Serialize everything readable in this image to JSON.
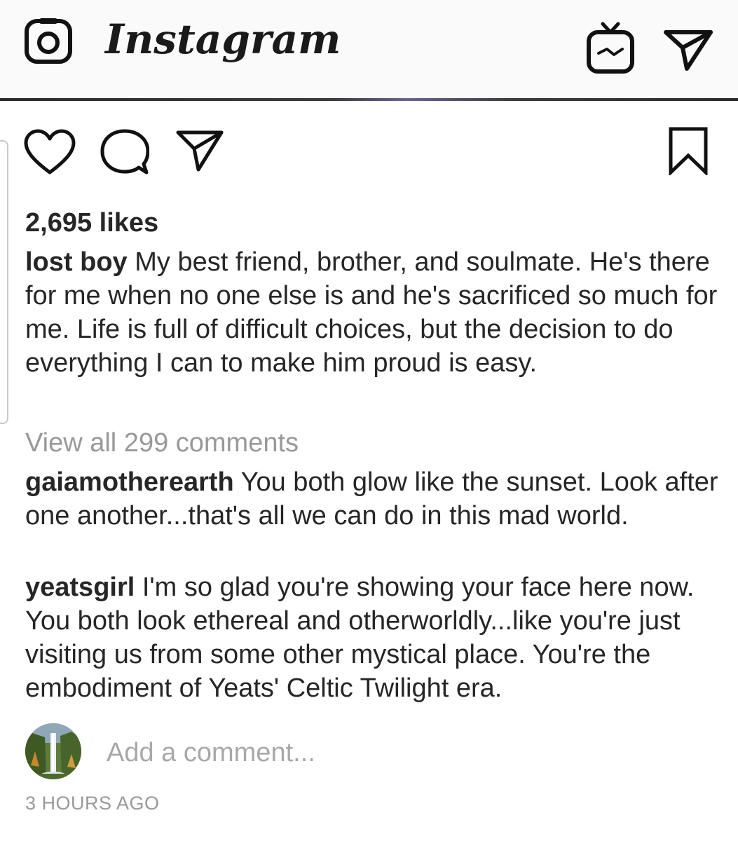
{
  "header": {
    "logo_text": "Instagram",
    "icons": [
      "camera-icon",
      "igtv-icon",
      "direct-message-icon"
    ]
  },
  "post": {
    "actions": [
      "heart-icon",
      "comment-bubble-icon",
      "share-paper-plane-icon",
      "bookmark-icon"
    ],
    "likes": "2,695 likes",
    "caption": {
      "username": "lost boy",
      "text": " My best friend, brother, and soulmate. He's there for me when no one else is and he's sacrificed so much for me. Life is full of difficult choices, but the decision to do everything I can to make him proud is easy."
    },
    "view_all_comments": "View all 299 comments",
    "comments": [
      {
        "username": "gaiamotherearth",
        "text": " You both glow like the sunset. Look after one another...that's all we can do in this mad world."
      },
      {
        "username": "yeatsgirl",
        "text": " I'm so glad you're showing your face here now. You both look ethereal and otherworldly...like you're just visiting us from some other mystical place. You're the embodiment of Yeats' Celtic Twilight era."
      }
    ],
    "add_comment_placeholder": "Add a comment...",
    "timestamp": "3 HOURS AGO"
  },
  "colors": {
    "text": "#262626",
    "muted": "#999999",
    "header_bg": "#fafafa"
  }
}
